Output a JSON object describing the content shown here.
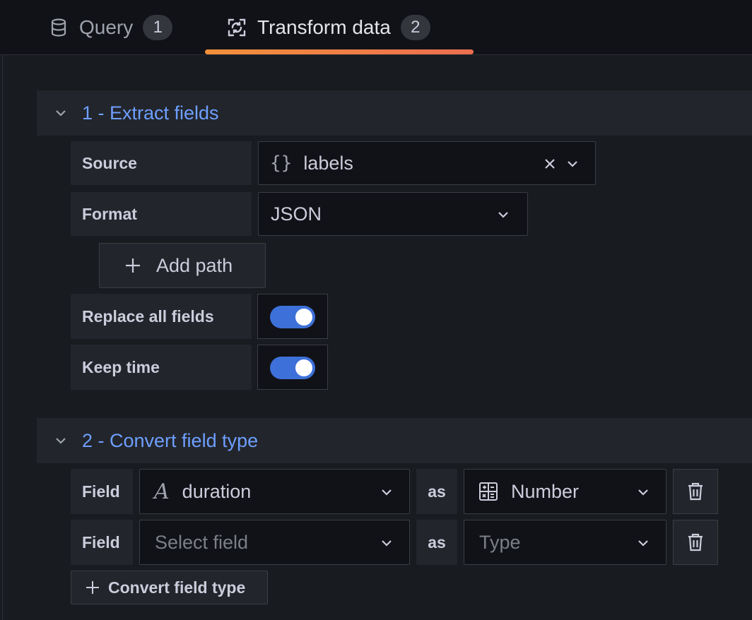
{
  "tabs": [
    {
      "label": "Query",
      "count": "1",
      "icon": "database-icon"
    },
    {
      "label": "Transform data",
      "count": "2",
      "icon": "transform-icon"
    }
  ],
  "colors": {
    "accent": "#6e9fff",
    "toggle_on": "#3d71d9",
    "tab_underline": "#f5903a"
  },
  "transformations": [
    {
      "title": "1 - Extract fields",
      "source": {
        "label": "Source",
        "value": "labels",
        "icon": "braces-icon"
      },
      "format": {
        "label": "Format",
        "value": "JSON"
      },
      "add_path_label": "Add path",
      "replace_all": {
        "label": "Replace all fields",
        "on": true
      },
      "keep_time": {
        "label": "Keep time",
        "on": true
      }
    },
    {
      "title": "2 - Convert field type",
      "rows": [
        {
          "field_label": "Field",
          "field_value": "duration",
          "field_icon": "italic-a-icon",
          "as_label": "as",
          "type_value": "Number",
          "type_icon": "calculator-icon"
        },
        {
          "field_label": "Field",
          "field_placeholder": "Select field",
          "as_label": "as",
          "type_placeholder": "Type"
        }
      ],
      "add_label": "Convert field type"
    }
  ]
}
